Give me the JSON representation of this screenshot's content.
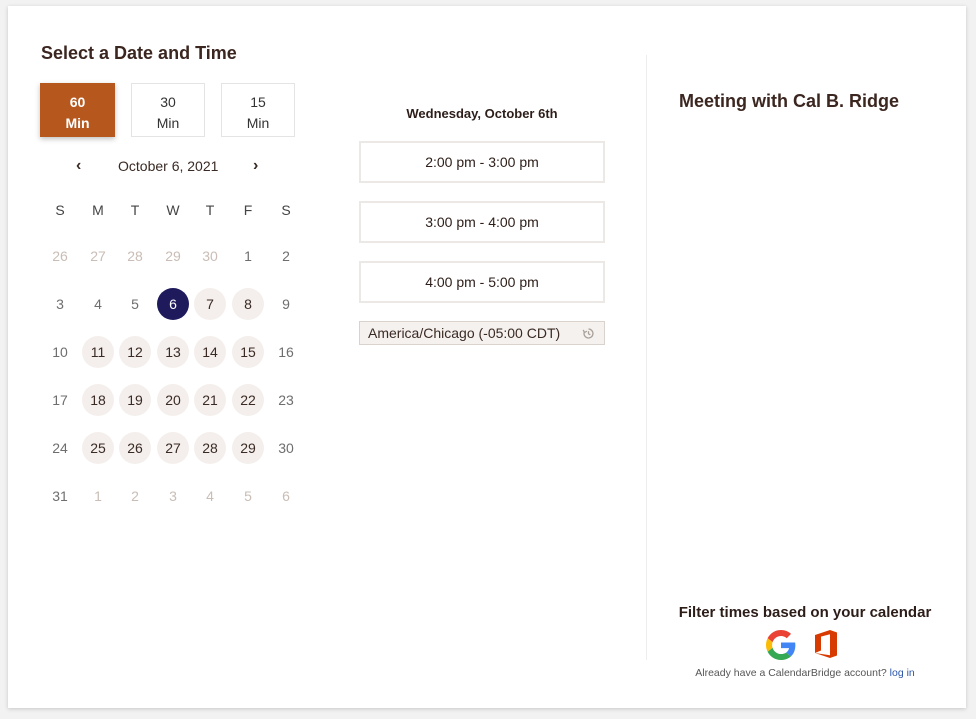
{
  "header": {
    "title": "Select a Date and Time"
  },
  "durations": [
    {
      "value": "60",
      "unit": "Min",
      "active": true
    },
    {
      "value": "30",
      "unit": "Min",
      "active": false
    },
    {
      "value": "15",
      "unit": "Min",
      "active": false
    }
  ],
  "calendar": {
    "month_label": "October 6, 2021",
    "prev_icon": "chevron-left-icon",
    "next_icon": "chevron-right-icon",
    "prev_glyph": "‹",
    "next_glyph": "›",
    "weekdays": [
      "S",
      "M",
      "T",
      "W",
      "T",
      "F",
      "S"
    ],
    "weeks": [
      [
        {
          "d": "26",
          "s": "muted"
        },
        {
          "d": "27",
          "s": "muted"
        },
        {
          "d": "28",
          "s": "muted"
        },
        {
          "d": "29",
          "s": "muted"
        },
        {
          "d": "30",
          "s": "muted"
        },
        {
          "d": "1",
          "s": "plain"
        },
        {
          "d": "2",
          "s": "plain"
        }
      ],
      [
        {
          "d": "3",
          "s": "plain"
        },
        {
          "d": "4",
          "s": "plain"
        },
        {
          "d": "5",
          "s": "plain"
        },
        {
          "d": "6",
          "s": "selected"
        },
        {
          "d": "7",
          "s": "avail"
        },
        {
          "d": "8",
          "s": "avail"
        },
        {
          "d": "9",
          "s": "plain"
        }
      ],
      [
        {
          "d": "10",
          "s": "plain"
        },
        {
          "d": "11",
          "s": "avail"
        },
        {
          "d": "12",
          "s": "avail"
        },
        {
          "d": "13",
          "s": "avail"
        },
        {
          "d": "14",
          "s": "avail"
        },
        {
          "d": "15",
          "s": "avail"
        },
        {
          "d": "16",
          "s": "plain"
        }
      ],
      [
        {
          "d": "17",
          "s": "plain"
        },
        {
          "d": "18",
          "s": "avail"
        },
        {
          "d": "19",
          "s": "avail"
        },
        {
          "d": "20",
          "s": "avail"
        },
        {
          "d": "21",
          "s": "avail"
        },
        {
          "d": "22",
          "s": "avail"
        },
        {
          "d": "23",
          "s": "plain"
        }
      ],
      [
        {
          "d": "24",
          "s": "plain"
        },
        {
          "d": "25",
          "s": "avail"
        },
        {
          "d": "26",
          "s": "avail"
        },
        {
          "d": "27",
          "s": "avail"
        },
        {
          "d": "28",
          "s": "avail"
        },
        {
          "d": "29",
          "s": "avail"
        },
        {
          "d": "30",
          "s": "plain"
        }
      ],
      [
        {
          "d": "31",
          "s": "plain"
        },
        {
          "d": "1",
          "s": "muted"
        },
        {
          "d": "2",
          "s": "muted"
        },
        {
          "d": "3",
          "s": "muted"
        },
        {
          "d": "4",
          "s": "muted"
        },
        {
          "d": "5",
          "s": "muted"
        },
        {
          "d": "6",
          "s": "muted"
        }
      ]
    ]
  },
  "times": {
    "date_heading": "Wednesday, October 6th",
    "slots": [
      "2:00 pm - 3:00 pm",
      "3:00 pm - 4:00 pm",
      "4:00 pm - 5:00 pm"
    ],
    "timezone": "America/Chicago (-05:00 CDT)",
    "timezone_icon": "history-icon"
  },
  "meeting": {
    "title": "Meeting with Cal B. Ridge"
  },
  "filter": {
    "heading": "Filter times based on your calendar",
    "providers": [
      "google-icon",
      "office-icon"
    ],
    "login_prefix": "Already have a CalendarBridge account?",
    "login_link": "log in"
  },
  "colors": {
    "accent": "#b6581e",
    "selected_day": "#1f1a5c",
    "available_day": "#f4efec",
    "text": "#3a2a24"
  }
}
